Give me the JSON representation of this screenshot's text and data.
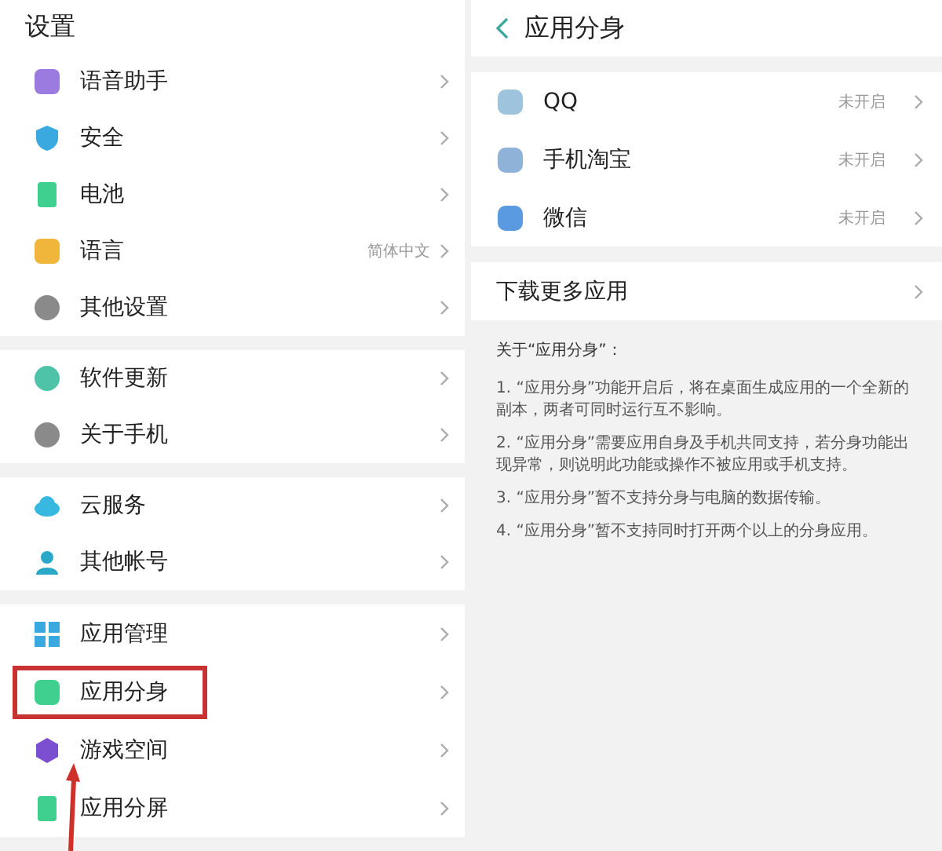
{
  "settings": {
    "title": "设置",
    "groups": [
      [
        {
          "label": "语音助手"
        },
        {
          "label": "安全"
        },
        {
          "label": "电池"
        },
        {
          "label": "语言",
          "value": "简体中文"
        },
        {
          "label": "其他设置"
        }
      ],
      [
        {
          "label": "软件更新"
        },
        {
          "label": "关于手机"
        }
      ],
      [
        {
          "label": "云服务"
        },
        {
          "label": "其他帐号"
        }
      ],
      [
        {
          "label": "应用管理",
          "highlighted": false
        },
        {
          "label": "应用分身",
          "highlighted": true
        },
        {
          "label": "游戏空间",
          "highlighted": false
        },
        {
          "label": "应用分屏",
          "highlighted": false
        }
      ]
    ]
  },
  "app_clone": {
    "title": "应用分身",
    "apps": [
      {
        "name": "QQ",
        "status": "未开启"
      },
      {
        "name": "手机淘宝",
        "status": "未开启"
      },
      {
        "name": "微信",
        "status": "未开启"
      }
    ],
    "download": "下载更多应用",
    "notes": {
      "heading": "关于“应用分身”：",
      "items": [
        "1. “应用分身”功能开启后，将在桌面生成应用的一个全新的副本，两者可同时运行互不影响。",
        "2. “应用分身”需要应用自身及手机共同支持，若分身功能出现异常，则说明此功能或操作不被应用或手机支持。",
        "3. “应用分身”暂不支持分身与电脑的数据传输。",
        "4. “应用分身”暂不支持同时打开两个以上的分身应用。"
      ]
    }
  }
}
